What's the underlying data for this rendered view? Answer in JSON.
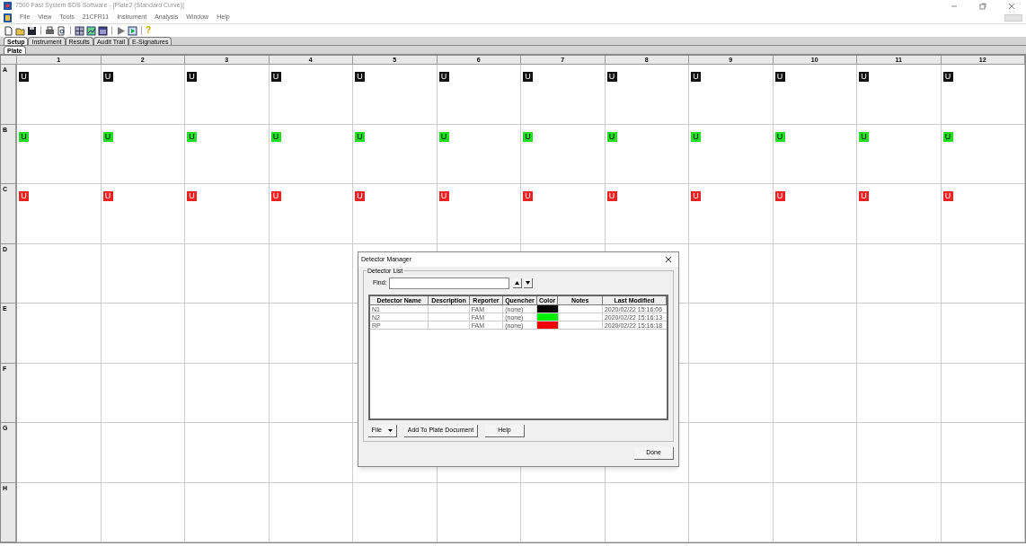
{
  "window": {
    "title": "7500 Fast System SDS Software - [Plate2 (Standard Curve)]"
  },
  "menu": [
    "File",
    "View",
    "Tools",
    "21CFR11",
    "Instrument",
    "Analysis",
    "Window",
    "Help"
  ],
  "toolbar": [
    {
      "kind": "new"
    },
    {
      "kind": "open"
    },
    {
      "kind": "save"
    },
    {
      "kind": "sep"
    },
    {
      "kind": "print"
    },
    {
      "kind": "preview"
    },
    {
      "kind": "sep"
    },
    {
      "kind": "grid"
    },
    {
      "kind": "chart"
    },
    {
      "kind": "analyze"
    },
    {
      "kind": "sep"
    },
    {
      "kind": "play"
    },
    {
      "kind": "run"
    },
    {
      "kind": "sep"
    },
    {
      "kind": "help",
      "label": "?"
    }
  ],
  "tabs": [
    {
      "label": "Setup",
      "selected": true
    },
    {
      "label": "Instrument",
      "selected": false
    },
    {
      "label": "Results",
      "selected": false
    },
    {
      "label": "Audit Trail",
      "selected": false
    },
    {
      "label": "E-Signatures",
      "selected": false
    }
  ],
  "subtabs": [
    {
      "label": "Plate",
      "selected": true
    }
  ],
  "plate": {
    "columns": [
      "1",
      "2",
      "3",
      "4",
      "5",
      "6",
      "7",
      "8",
      "9",
      "10",
      "11",
      "12"
    ],
    "rows": [
      {
        "label": "A",
        "wells": [
          {
            "text": "U",
            "color": "#111111"
          },
          {
            "text": "U",
            "color": "#111111"
          },
          {
            "text": "U",
            "color": "#111111"
          },
          {
            "text": "U",
            "color": "#111111"
          },
          {
            "text": "U",
            "color": "#111111"
          },
          {
            "text": "U",
            "color": "#111111"
          },
          {
            "text": "U",
            "color": "#111111"
          },
          {
            "text": "U",
            "color": "#111111"
          },
          {
            "text": "U",
            "color": "#111111"
          },
          {
            "text": "U",
            "color": "#111111"
          },
          {
            "text": "U",
            "color": "#111111"
          },
          {
            "text": "U",
            "color": "#111111"
          }
        ]
      },
      {
        "label": "B",
        "wells": [
          {
            "text": "U",
            "color": "#22dd22"
          },
          {
            "text": "U",
            "color": "#22dd22"
          },
          {
            "text": "U",
            "color": "#22dd22"
          },
          {
            "text": "U",
            "color": "#22dd22"
          },
          {
            "text": "U",
            "color": "#22dd22"
          },
          {
            "text": "U",
            "color": "#22dd22"
          },
          {
            "text": "U",
            "color": "#22dd22"
          },
          {
            "text": "U",
            "color": "#22dd22"
          },
          {
            "text": "U",
            "color": "#22dd22"
          },
          {
            "text": "U",
            "color": "#22dd22"
          },
          {
            "text": "U",
            "color": "#22dd22"
          },
          {
            "text": "U",
            "color": "#22dd22"
          }
        ]
      },
      {
        "label": "C",
        "wells": [
          {
            "text": "U",
            "color": "#ee2222"
          },
          {
            "text": "U",
            "color": "#ee2222"
          },
          {
            "text": "U",
            "color": "#ee2222"
          },
          {
            "text": "U",
            "color": "#ee2222"
          },
          {
            "text": "U",
            "color": "#ee2222"
          },
          {
            "text": "U",
            "color": "#ee2222"
          },
          {
            "text": "U",
            "color": "#ee2222"
          },
          {
            "text": "U",
            "color": "#ee2222"
          },
          {
            "text": "U",
            "color": "#ee2222"
          },
          {
            "text": "U",
            "color": "#ee2222"
          },
          {
            "text": "U",
            "color": "#ee2222"
          },
          {
            "text": "U",
            "color": "#ee2222"
          }
        ]
      },
      {
        "label": "D"
      },
      {
        "label": "E"
      },
      {
        "label": "F"
      },
      {
        "label": "G"
      },
      {
        "label": "H"
      }
    ]
  },
  "dialog": {
    "title": "Detector Manager",
    "group": "Detector List",
    "find_label": "Find:",
    "columns": [
      "Detector Name",
      "Description",
      "Reporter",
      "Quencher",
      "Color",
      "Notes",
      "Last Modified"
    ],
    "rows": [
      {
        "name": "N1",
        "reporter": "FAM",
        "quencher": "(none)",
        "color": "#000000",
        "modified": "2020/02/22 15:16:06"
      },
      {
        "name": "N2",
        "reporter": "FAM",
        "quencher": "(none)",
        "color": "#00ee00",
        "modified": "2020/02/22 15:16:13"
      },
      {
        "name": "RP",
        "reporter": "FAM",
        "quencher": "(none)",
        "color": "#ee0000",
        "modified": "2020/02/22 15:16:18"
      }
    ],
    "buttons": [
      "File",
      "Add To Plate Document",
      "Help"
    ],
    "done": "Done"
  }
}
